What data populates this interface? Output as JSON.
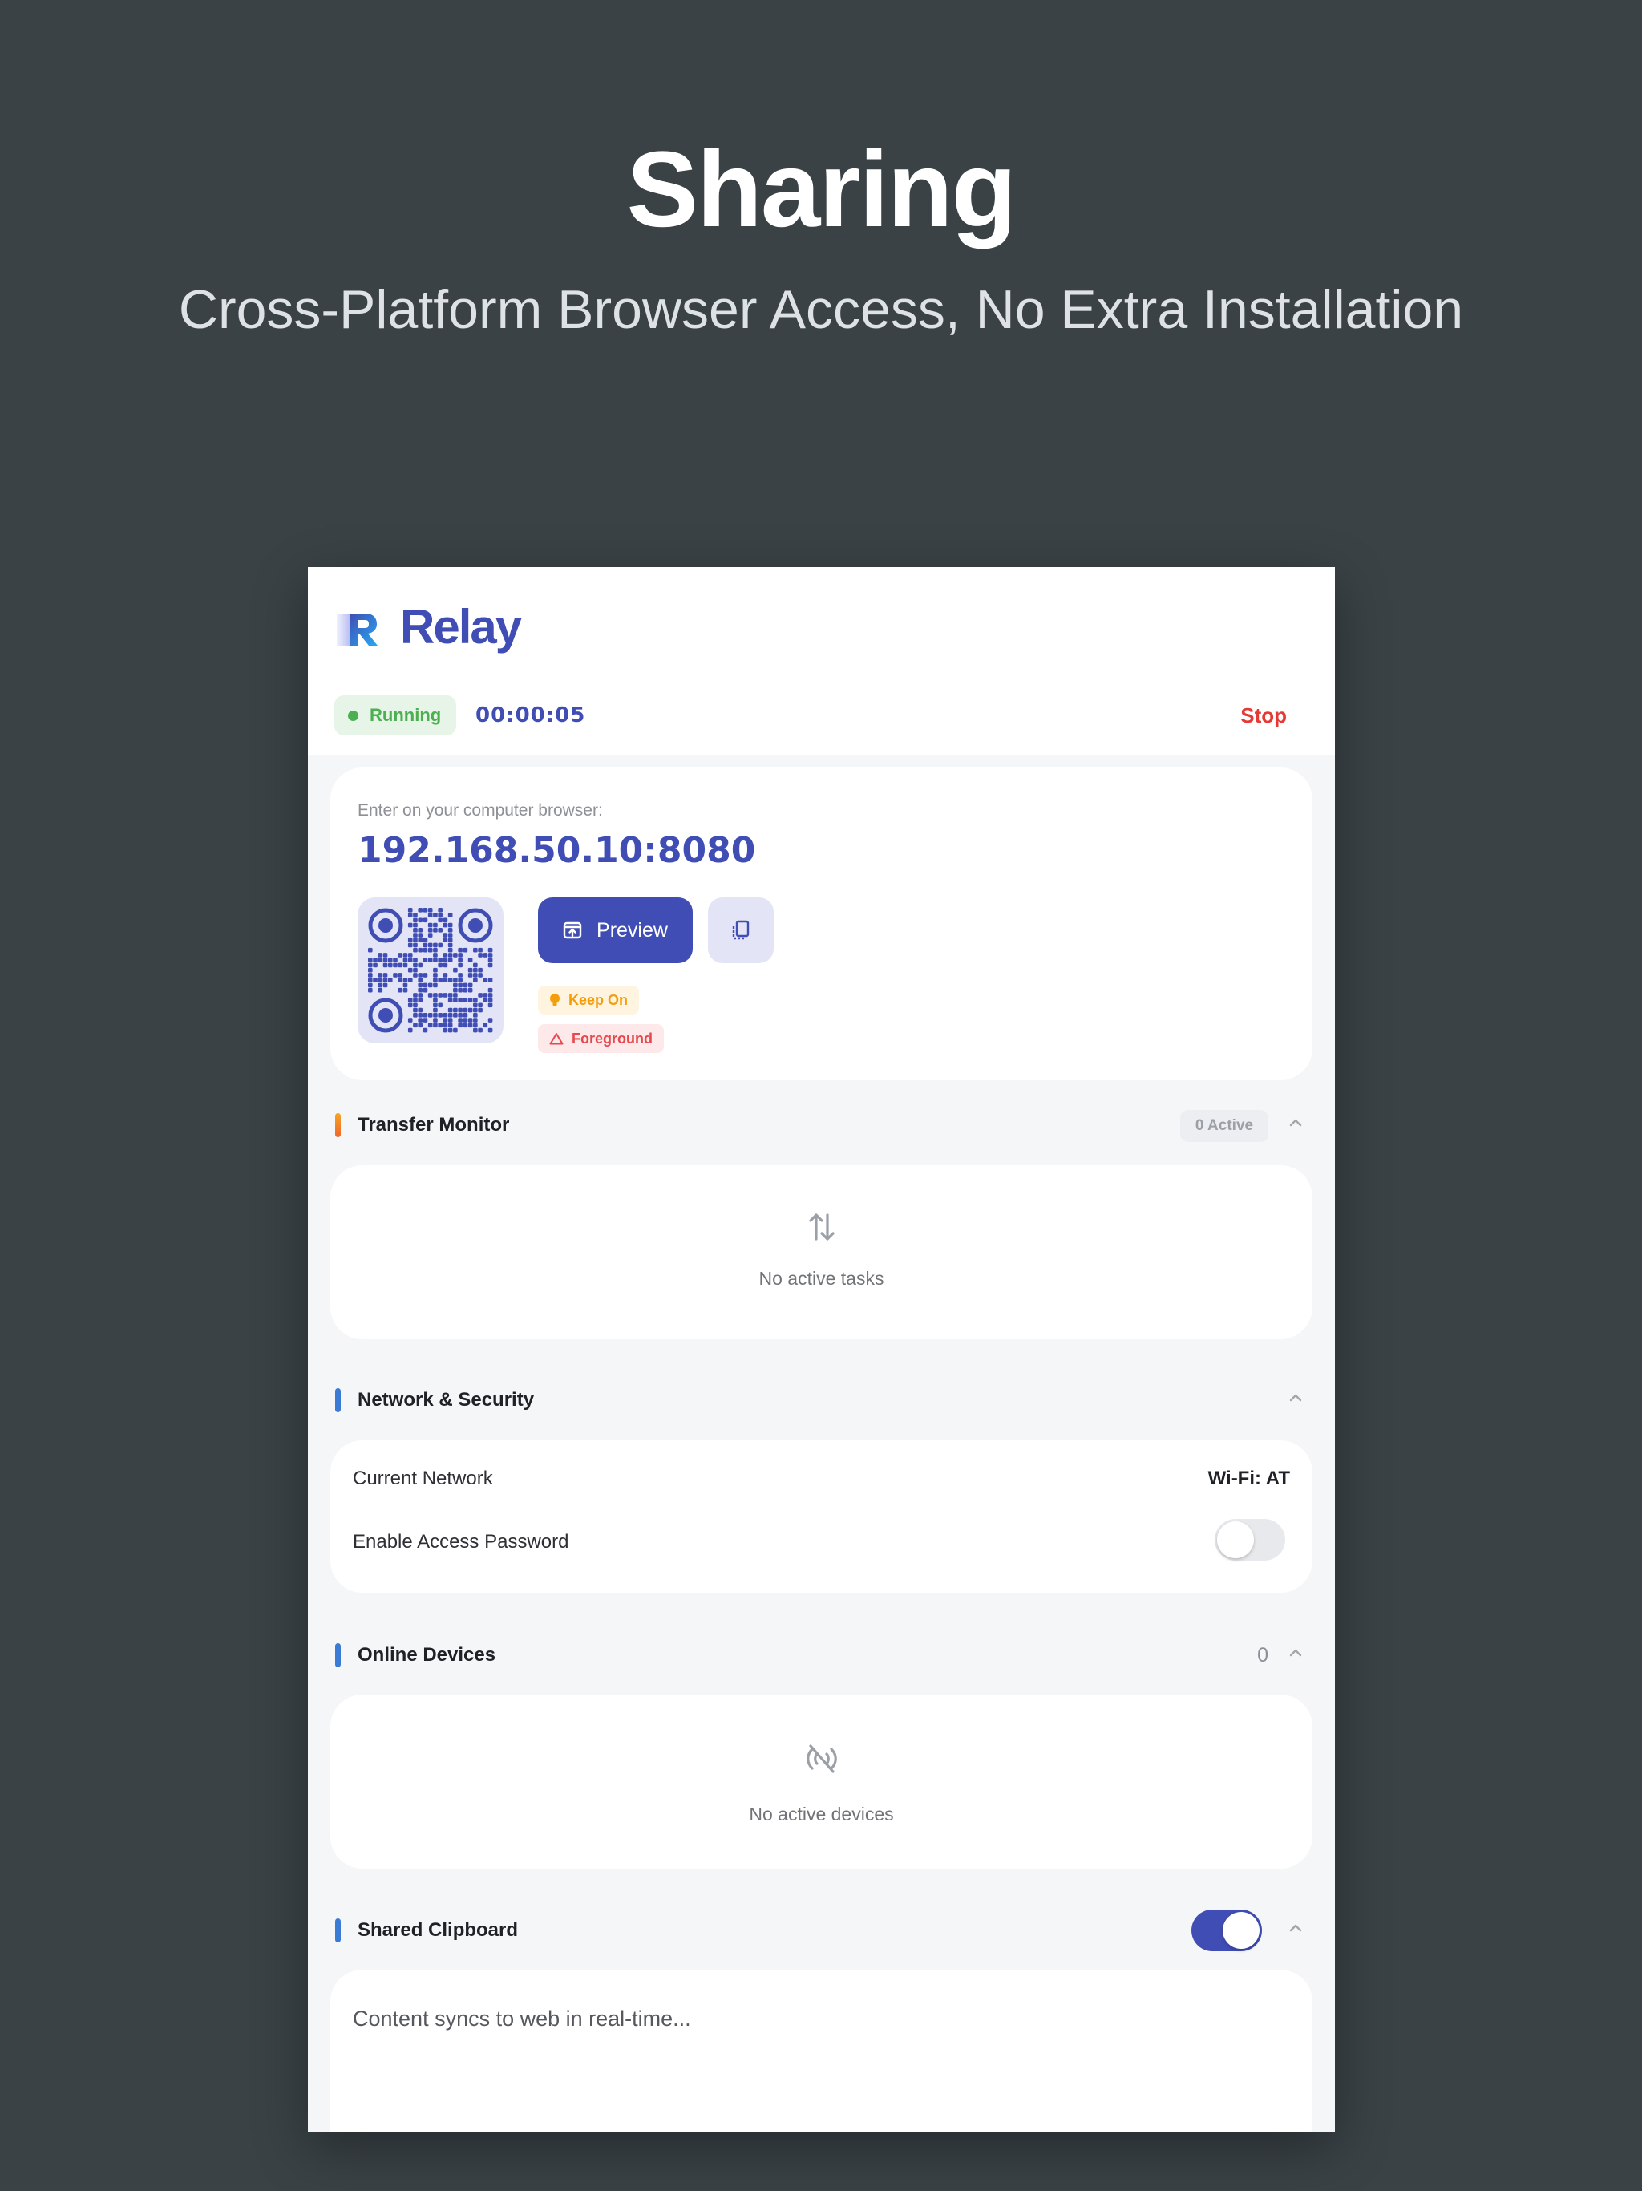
{
  "hero": {
    "title": "Sharing",
    "subtitle": "Cross-Platform Browser Access, No Extra Installation"
  },
  "app": {
    "name": "Relay",
    "status": "Running",
    "timer": "00:00:05",
    "stop_label": "Stop",
    "colors": {
      "brand": "#3f4db4",
      "running": "#4caf50",
      "stop": "#e53935"
    }
  },
  "connection": {
    "instruction": "Enter on your computer browser:",
    "address": "192.168.50.10:8080",
    "preview_label": "Preview",
    "copy_icon": "copy-icon",
    "chips": [
      {
        "label": "Keep On",
        "icon": "lightbulb-icon"
      },
      {
        "label": "Foreground",
        "icon": "warning-icon"
      }
    ]
  },
  "transfer_monitor": {
    "title": "Transfer Monitor",
    "badge": "0 Active",
    "empty_text": "No active tasks"
  },
  "network_security": {
    "title": "Network & Security",
    "current_network_label": "Current Network",
    "current_network_value": "Wi-Fi: AT",
    "password_label": "Enable Access Password",
    "password_enabled": false
  },
  "online_devices": {
    "title": "Online Devices",
    "count": "0",
    "empty_text": "No active devices"
  },
  "shared_clipboard": {
    "title": "Shared Clipboard",
    "enabled": true,
    "placeholder": "Content syncs to web in real-time..."
  }
}
